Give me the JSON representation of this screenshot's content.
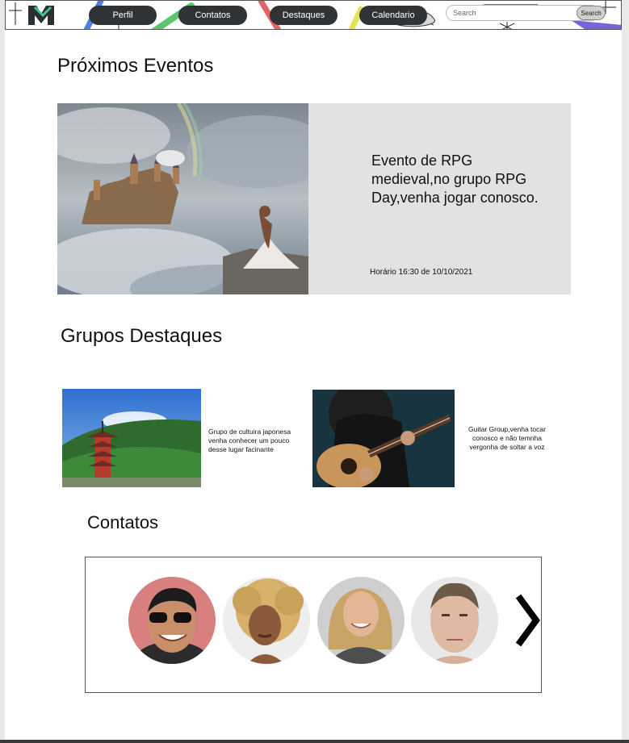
{
  "nav": {
    "items": [
      {
        "label": "Perfil"
      },
      {
        "label": "Contatos"
      },
      {
        "label": "Destaques"
      },
      {
        "label": "Calendario"
      }
    ],
    "search_placeholder": "Search",
    "search_button": "Search"
  },
  "events": {
    "title": "Próximos Eventos",
    "description": "Evento de RPG medieval,no grupo RPG Day,venha jogar conosco.",
    "time": "Horário 16:30 de 10/10/2021"
  },
  "highlights": {
    "title": "Grupos Destaques",
    "groups": [
      {
        "text": "Grupo de cultuira japonesa venha conhecer um pouco desse lugar facinante"
      },
      {
        "text": "Guitar Group,venha tocar conosco e não temnha vergonha de soltar a voz"
      }
    ]
  },
  "contacts": {
    "title": "Contatos"
  },
  "icons": {
    "logo": "logo-icon",
    "next": "chevron-right-icon"
  },
  "colors": {
    "nav_button": "#2f3336",
    "event_panel": "#e2e2e2"
  }
}
